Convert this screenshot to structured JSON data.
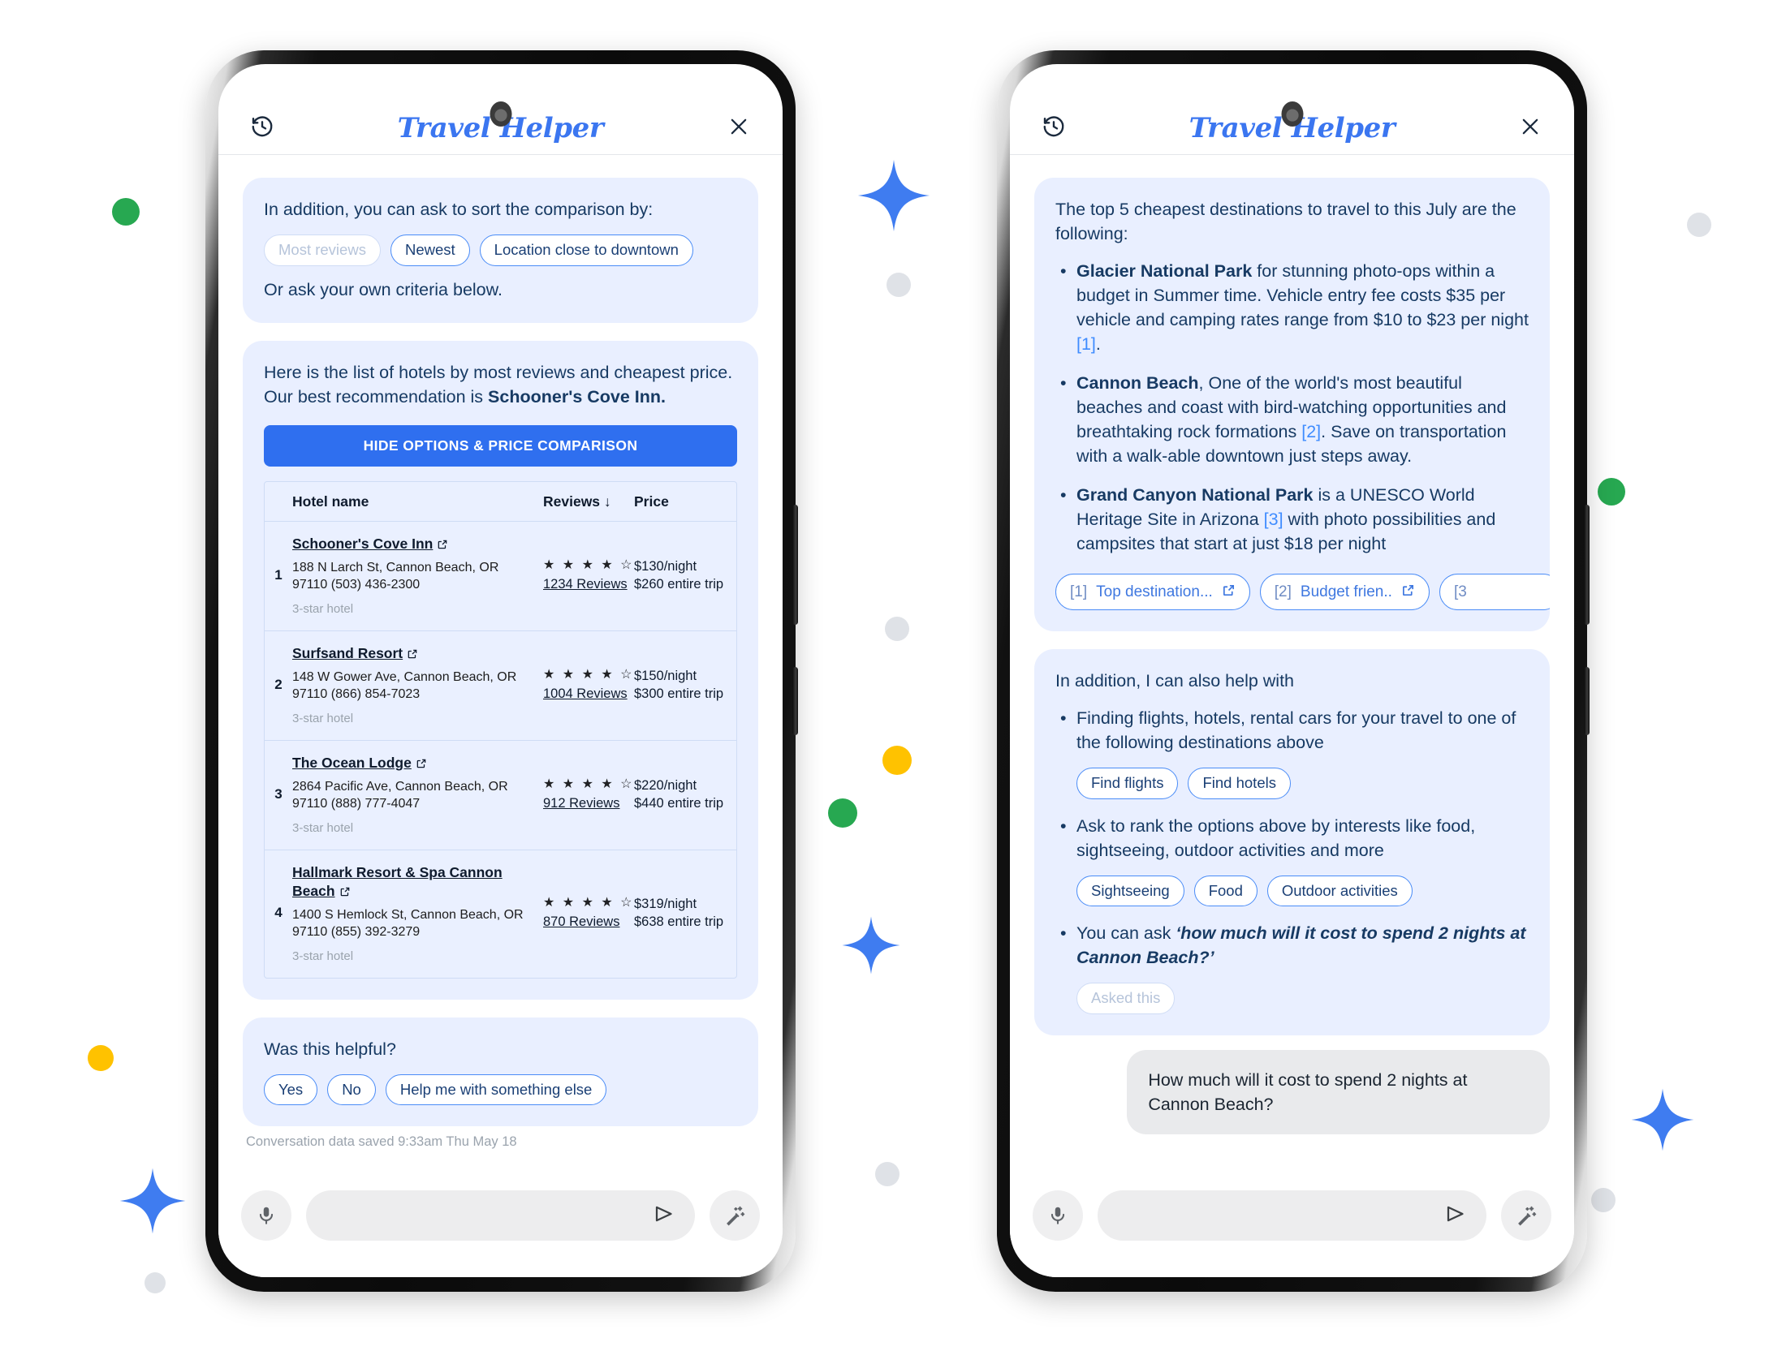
{
  "app": {
    "title": "Travel Helper",
    "history_icon": "history-icon",
    "close_icon": "close-icon"
  },
  "composer": {
    "mic_icon": "microphone-icon",
    "send_icon": "send-icon",
    "magic_icon": "magic-wand-icon",
    "placeholder": ""
  },
  "colors": {
    "accent_blue": "#3b76f0",
    "bubble_bg": "#e9efff",
    "primary_button": "#2f6fef",
    "green_dot": "#27a851",
    "yellow_dot": "#ffc200",
    "grey_dot": "#dadde2",
    "sparkle": "#3f7cf0",
    "user_bubble": "#e9eaec"
  },
  "left_phone": {
    "sort_card": {
      "prompt": "In addition, you can ask to sort the comparison by:",
      "chips": [
        {
          "label": "Most reviews",
          "state": "disabled"
        },
        {
          "label": "Newest",
          "state": "enabled"
        },
        {
          "label": "Location close to downtown",
          "state": "enabled"
        }
      ],
      "footer": "Or ask your own criteria below."
    },
    "hotels_card": {
      "intro_plain": "Here is the list of hotels by most reviews and cheapest price. Our best recommendation is ",
      "intro_bold": "Schooner's Cove Inn.",
      "toggle_button": "HIDE OPTIONS & PRICE COMPARISON",
      "table": {
        "headers": {
          "index": "",
          "name": "Hotel name",
          "reviews": "Reviews ↓",
          "price": "Price"
        },
        "rows": [
          {
            "index": "1",
            "name": "Schooner's Cove Inn",
            "address": "188 N Larch St, Cannon Beach, OR 97110 (503) 436-2300",
            "grade": "3-star hotel",
            "stars": "★ ★ ★ ★ ☆",
            "reviews": "1234 Reviews",
            "price_night": "$130/night",
            "price_trip": "$260 entire trip"
          },
          {
            "index": "2",
            "name": "Surfsand Resort",
            "address": "148 W Gower Ave, Cannon Beach, OR 97110 (866) 854-7023",
            "grade": "3-star hotel",
            "stars": "★ ★ ★ ★ ☆",
            "reviews": "1004 Reviews",
            "price_night": "$150/night",
            "price_trip": "$300 entire trip"
          },
          {
            "index": "3",
            "name": "The Ocean Lodge",
            "address": "2864 Pacific Ave, Cannon Beach, OR 97110 (888) 777-4047",
            "grade": "3-star hotel",
            "stars": "★ ★ ★ ★ ☆",
            "reviews": "912 Reviews",
            "price_night": "$220/night",
            "price_trip": "$440 entire trip"
          },
          {
            "index": "4",
            "name": "Hallmark Resort & Spa Cannon Beach",
            "address": "1400 S Hemlock St, Cannon Beach, OR 97110 (855) 392-3279",
            "grade": "3-star hotel",
            "stars": "★ ★ ★ ★ ☆",
            "reviews": "870 Reviews",
            "price_night": "$319/night",
            "price_trip": "$638 entire trip"
          }
        ]
      }
    },
    "feedback_card": {
      "question": "Was this helpful?",
      "chips": [
        {
          "label": "Yes",
          "state": "enabled"
        },
        {
          "label": "No",
          "state": "enabled"
        },
        {
          "label": "Help me with something else",
          "state": "enabled"
        }
      ]
    },
    "saved_note": "Conversation data saved 9:33am Thu May 18"
  },
  "right_phone": {
    "destinations_card": {
      "intro": "The top 5 cheapest destinations to travel to this July are the following:",
      "bullets": [
        {
          "title": "Glacier National Park",
          "text": " for stunning photo-ops within a budget in Summer time. Vehicle entry fee costs $35 per vehicle and camping rates range from $10 to $23 per night ",
          "ref": "[1]",
          "tail": "."
        },
        {
          "title": "Cannon Beach",
          "text": ", One of the world's most beautiful beaches and coast with bird-watching opportunities and breathtaking rock formations ",
          "ref": "[2]",
          "tail": ". Save on transportation with a walk-able downtown just steps away."
        },
        {
          "title": "Grand Canyon National Park",
          "text": " is a UNESCO World Heritage Site in Arizona ",
          "ref": "[3]",
          "tail": " with photo possibilities and campsites that start at just $18 per night"
        }
      ],
      "citations": [
        {
          "num": "[1]",
          "label": "Top destination..."
        },
        {
          "num": "[2]",
          "label": "Budget frien.."
        },
        {
          "num": "[3",
          "label": ""
        }
      ]
    },
    "help_card": {
      "title": "In addition, I can also help with",
      "items": [
        {
          "text": "Finding flights, hotels, rental cars for your travel to one of the following destinations above",
          "chips": [
            {
              "label": "Find flights",
              "state": "enabled"
            },
            {
              "label": "Find hotels",
              "state": "enabled"
            }
          ]
        },
        {
          "text": "Ask to rank the options above by interests like food, sightseeing, outdoor activities and more",
          "chips": [
            {
              "label": "Sightseeing",
              "state": "enabled"
            },
            {
              "label": "Food",
              "state": "enabled"
            },
            {
              "label": "Outdoor activities",
              "state": "enabled"
            }
          ]
        },
        {
          "text_plain": "You can ask ",
          "text_italic": "‘how much will it cost to spend 2 nights at Cannon Beach?’",
          "chips": [
            {
              "label": "Asked this",
              "state": "disabled"
            }
          ]
        }
      ]
    },
    "user_message": "How much will it cost to spend 2 nights at Cannon Beach?"
  }
}
